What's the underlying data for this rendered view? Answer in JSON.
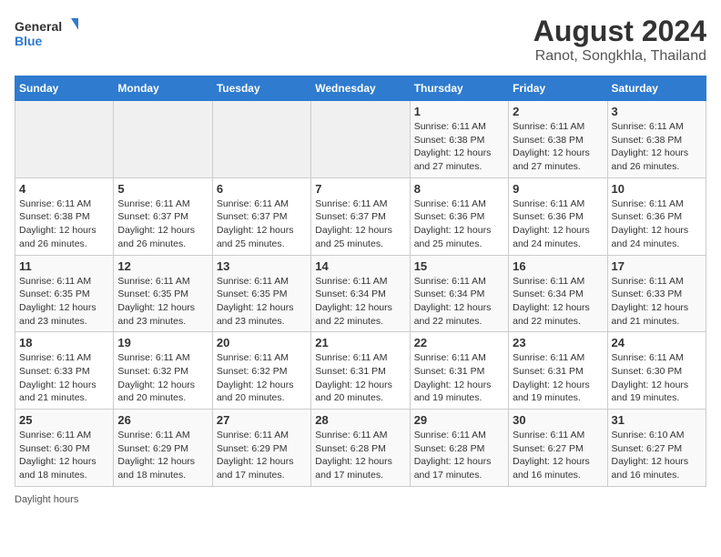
{
  "header": {
    "logo_line1": "General",
    "logo_line2": "Blue",
    "title": "August 2024",
    "subtitle": "Ranot, Songkhla, Thailand"
  },
  "weekdays": [
    "Sunday",
    "Monday",
    "Tuesday",
    "Wednesday",
    "Thursday",
    "Friday",
    "Saturday"
  ],
  "weeks": [
    [
      {
        "day": "",
        "info": ""
      },
      {
        "day": "",
        "info": ""
      },
      {
        "day": "",
        "info": ""
      },
      {
        "day": "",
        "info": ""
      },
      {
        "day": "1",
        "info": "Sunrise: 6:11 AM\nSunset: 6:38 PM\nDaylight: 12 hours\nand 27 minutes."
      },
      {
        "day": "2",
        "info": "Sunrise: 6:11 AM\nSunset: 6:38 PM\nDaylight: 12 hours\nand 27 minutes."
      },
      {
        "day": "3",
        "info": "Sunrise: 6:11 AM\nSunset: 6:38 PM\nDaylight: 12 hours\nand 26 minutes."
      }
    ],
    [
      {
        "day": "4",
        "info": "Sunrise: 6:11 AM\nSunset: 6:38 PM\nDaylight: 12 hours\nand 26 minutes."
      },
      {
        "day": "5",
        "info": "Sunrise: 6:11 AM\nSunset: 6:37 PM\nDaylight: 12 hours\nand 26 minutes."
      },
      {
        "day": "6",
        "info": "Sunrise: 6:11 AM\nSunset: 6:37 PM\nDaylight: 12 hours\nand 25 minutes."
      },
      {
        "day": "7",
        "info": "Sunrise: 6:11 AM\nSunset: 6:37 PM\nDaylight: 12 hours\nand 25 minutes."
      },
      {
        "day": "8",
        "info": "Sunrise: 6:11 AM\nSunset: 6:36 PM\nDaylight: 12 hours\nand 25 minutes."
      },
      {
        "day": "9",
        "info": "Sunrise: 6:11 AM\nSunset: 6:36 PM\nDaylight: 12 hours\nand 24 minutes."
      },
      {
        "day": "10",
        "info": "Sunrise: 6:11 AM\nSunset: 6:36 PM\nDaylight: 12 hours\nand 24 minutes."
      }
    ],
    [
      {
        "day": "11",
        "info": "Sunrise: 6:11 AM\nSunset: 6:35 PM\nDaylight: 12 hours\nand 23 minutes."
      },
      {
        "day": "12",
        "info": "Sunrise: 6:11 AM\nSunset: 6:35 PM\nDaylight: 12 hours\nand 23 minutes."
      },
      {
        "day": "13",
        "info": "Sunrise: 6:11 AM\nSunset: 6:35 PM\nDaylight: 12 hours\nand 23 minutes."
      },
      {
        "day": "14",
        "info": "Sunrise: 6:11 AM\nSunset: 6:34 PM\nDaylight: 12 hours\nand 22 minutes."
      },
      {
        "day": "15",
        "info": "Sunrise: 6:11 AM\nSunset: 6:34 PM\nDaylight: 12 hours\nand 22 minutes."
      },
      {
        "day": "16",
        "info": "Sunrise: 6:11 AM\nSunset: 6:34 PM\nDaylight: 12 hours\nand 22 minutes."
      },
      {
        "day": "17",
        "info": "Sunrise: 6:11 AM\nSunset: 6:33 PM\nDaylight: 12 hours\nand 21 minutes."
      }
    ],
    [
      {
        "day": "18",
        "info": "Sunrise: 6:11 AM\nSunset: 6:33 PM\nDaylight: 12 hours\nand 21 minutes."
      },
      {
        "day": "19",
        "info": "Sunrise: 6:11 AM\nSunset: 6:32 PM\nDaylight: 12 hours\nand 20 minutes."
      },
      {
        "day": "20",
        "info": "Sunrise: 6:11 AM\nSunset: 6:32 PM\nDaylight: 12 hours\nand 20 minutes."
      },
      {
        "day": "21",
        "info": "Sunrise: 6:11 AM\nSunset: 6:31 PM\nDaylight: 12 hours\nand 20 minutes."
      },
      {
        "day": "22",
        "info": "Sunrise: 6:11 AM\nSunset: 6:31 PM\nDaylight: 12 hours\nand 19 minutes."
      },
      {
        "day": "23",
        "info": "Sunrise: 6:11 AM\nSunset: 6:31 PM\nDaylight: 12 hours\nand 19 minutes."
      },
      {
        "day": "24",
        "info": "Sunrise: 6:11 AM\nSunset: 6:30 PM\nDaylight: 12 hours\nand 19 minutes."
      }
    ],
    [
      {
        "day": "25",
        "info": "Sunrise: 6:11 AM\nSunset: 6:30 PM\nDaylight: 12 hours\nand 18 minutes."
      },
      {
        "day": "26",
        "info": "Sunrise: 6:11 AM\nSunset: 6:29 PM\nDaylight: 12 hours\nand 18 minutes."
      },
      {
        "day": "27",
        "info": "Sunrise: 6:11 AM\nSunset: 6:29 PM\nDaylight: 12 hours\nand 17 minutes."
      },
      {
        "day": "28",
        "info": "Sunrise: 6:11 AM\nSunset: 6:28 PM\nDaylight: 12 hours\nand 17 minutes."
      },
      {
        "day": "29",
        "info": "Sunrise: 6:11 AM\nSunset: 6:28 PM\nDaylight: 12 hours\nand 17 minutes."
      },
      {
        "day": "30",
        "info": "Sunrise: 6:11 AM\nSunset: 6:27 PM\nDaylight: 12 hours\nand 16 minutes."
      },
      {
        "day": "31",
        "info": "Sunrise: 6:10 AM\nSunset: 6:27 PM\nDaylight: 12 hours\nand 16 minutes."
      }
    ]
  ],
  "footer": "Daylight hours"
}
